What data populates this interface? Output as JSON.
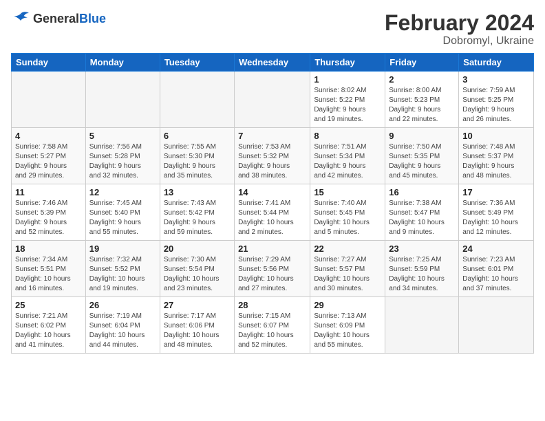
{
  "logo": {
    "general": "General",
    "blue": "Blue"
  },
  "header": {
    "month_year": "February 2024",
    "location": "Dobromyl, Ukraine"
  },
  "days_of_week": [
    "Sunday",
    "Monday",
    "Tuesday",
    "Wednesday",
    "Thursday",
    "Friday",
    "Saturday"
  ],
  "weeks": [
    [
      {
        "day": "",
        "info": ""
      },
      {
        "day": "",
        "info": ""
      },
      {
        "day": "",
        "info": ""
      },
      {
        "day": "",
        "info": ""
      },
      {
        "day": "1",
        "info": "Sunrise: 8:02 AM\nSunset: 5:22 PM\nDaylight: 9 hours\nand 19 minutes."
      },
      {
        "day": "2",
        "info": "Sunrise: 8:00 AM\nSunset: 5:23 PM\nDaylight: 9 hours\nand 22 minutes."
      },
      {
        "day": "3",
        "info": "Sunrise: 7:59 AM\nSunset: 5:25 PM\nDaylight: 9 hours\nand 26 minutes."
      }
    ],
    [
      {
        "day": "4",
        "info": "Sunrise: 7:58 AM\nSunset: 5:27 PM\nDaylight: 9 hours\nand 29 minutes."
      },
      {
        "day": "5",
        "info": "Sunrise: 7:56 AM\nSunset: 5:28 PM\nDaylight: 9 hours\nand 32 minutes."
      },
      {
        "day": "6",
        "info": "Sunrise: 7:55 AM\nSunset: 5:30 PM\nDaylight: 9 hours\nand 35 minutes."
      },
      {
        "day": "7",
        "info": "Sunrise: 7:53 AM\nSunset: 5:32 PM\nDaylight: 9 hours\nand 38 minutes."
      },
      {
        "day": "8",
        "info": "Sunrise: 7:51 AM\nSunset: 5:34 PM\nDaylight: 9 hours\nand 42 minutes."
      },
      {
        "day": "9",
        "info": "Sunrise: 7:50 AM\nSunset: 5:35 PM\nDaylight: 9 hours\nand 45 minutes."
      },
      {
        "day": "10",
        "info": "Sunrise: 7:48 AM\nSunset: 5:37 PM\nDaylight: 9 hours\nand 48 minutes."
      }
    ],
    [
      {
        "day": "11",
        "info": "Sunrise: 7:46 AM\nSunset: 5:39 PM\nDaylight: 9 hours\nand 52 minutes."
      },
      {
        "day": "12",
        "info": "Sunrise: 7:45 AM\nSunset: 5:40 PM\nDaylight: 9 hours\nand 55 minutes."
      },
      {
        "day": "13",
        "info": "Sunrise: 7:43 AM\nSunset: 5:42 PM\nDaylight: 9 hours\nand 59 minutes."
      },
      {
        "day": "14",
        "info": "Sunrise: 7:41 AM\nSunset: 5:44 PM\nDaylight: 10 hours\nand 2 minutes."
      },
      {
        "day": "15",
        "info": "Sunrise: 7:40 AM\nSunset: 5:45 PM\nDaylight: 10 hours\nand 5 minutes."
      },
      {
        "day": "16",
        "info": "Sunrise: 7:38 AM\nSunset: 5:47 PM\nDaylight: 10 hours\nand 9 minutes."
      },
      {
        "day": "17",
        "info": "Sunrise: 7:36 AM\nSunset: 5:49 PM\nDaylight: 10 hours\nand 12 minutes."
      }
    ],
    [
      {
        "day": "18",
        "info": "Sunrise: 7:34 AM\nSunset: 5:51 PM\nDaylight: 10 hours\nand 16 minutes."
      },
      {
        "day": "19",
        "info": "Sunrise: 7:32 AM\nSunset: 5:52 PM\nDaylight: 10 hours\nand 19 minutes."
      },
      {
        "day": "20",
        "info": "Sunrise: 7:30 AM\nSunset: 5:54 PM\nDaylight: 10 hours\nand 23 minutes."
      },
      {
        "day": "21",
        "info": "Sunrise: 7:29 AM\nSunset: 5:56 PM\nDaylight: 10 hours\nand 27 minutes."
      },
      {
        "day": "22",
        "info": "Sunrise: 7:27 AM\nSunset: 5:57 PM\nDaylight: 10 hours\nand 30 minutes."
      },
      {
        "day": "23",
        "info": "Sunrise: 7:25 AM\nSunset: 5:59 PM\nDaylight: 10 hours\nand 34 minutes."
      },
      {
        "day": "24",
        "info": "Sunrise: 7:23 AM\nSunset: 6:01 PM\nDaylight: 10 hours\nand 37 minutes."
      }
    ],
    [
      {
        "day": "25",
        "info": "Sunrise: 7:21 AM\nSunset: 6:02 PM\nDaylight: 10 hours\nand 41 minutes."
      },
      {
        "day": "26",
        "info": "Sunrise: 7:19 AM\nSunset: 6:04 PM\nDaylight: 10 hours\nand 44 minutes."
      },
      {
        "day": "27",
        "info": "Sunrise: 7:17 AM\nSunset: 6:06 PM\nDaylight: 10 hours\nand 48 minutes."
      },
      {
        "day": "28",
        "info": "Sunrise: 7:15 AM\nSunset: 6:07 PM\nDaylight: 10 hours\nand 52 minutes."
      },
      {
        "day": "29",
        "info": "Sunrise: 7:13 AM\nSunset: 6:09 PM\nDaylight: 10 hours\nand 55 minutes."
      },
      {
        "day": "",
        "info": ""
      },
      {
        "day": "",
        "info": ""
      }
    ]
  ]
}
